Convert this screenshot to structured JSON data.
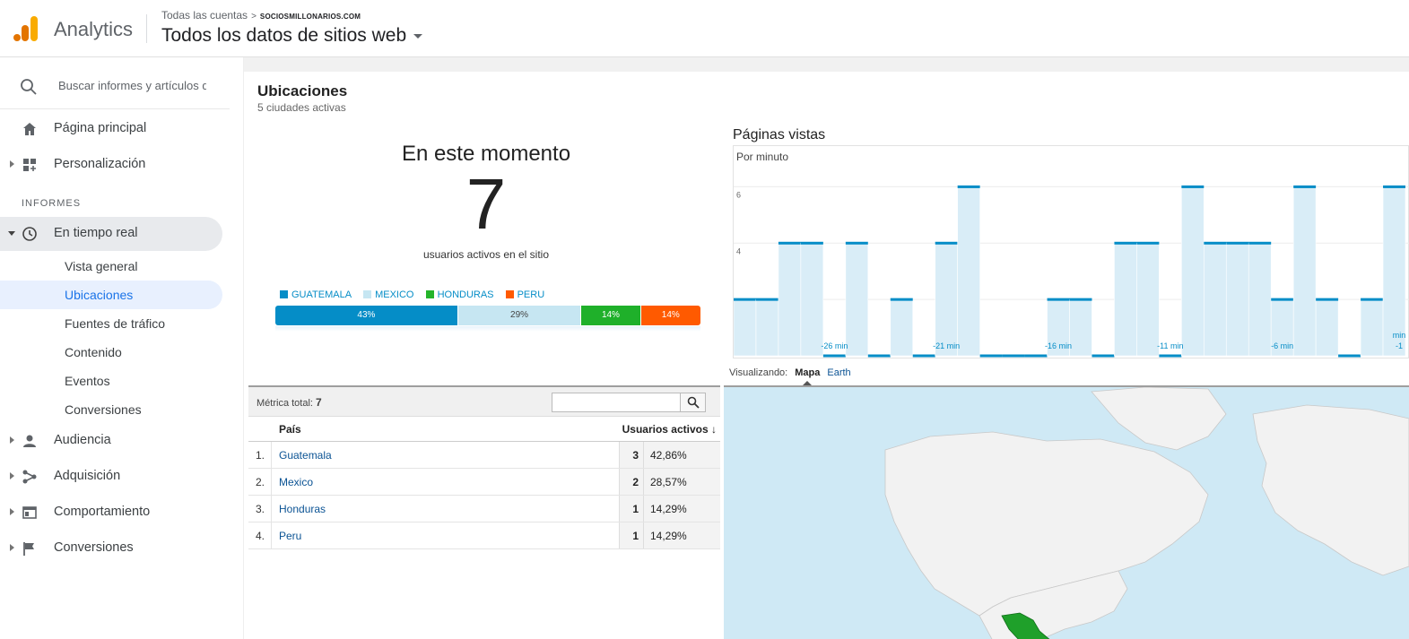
{
  "header": {
    "app_name": "Analytics",
    "breadcrumb_all": "Todas las cuentas",
    "breadcrumb_sep": ">",
    "breadcrumb_site": "SOCIOSMILLONARIOS.COM",
    "view_name": "Todos los datos de sitios web"
  },
  "sidebar": {
    "search_placeholder": "Buscar informes y artículos d",
    "home": "Página principal",
    "customization": "Personalización",
    "section_label": "INFORMES",
    "realtime": "En tiempo real",
    "realtime_items": [
      "Vista general",
      "Ubicaciones",
      "Fuentes de tráfico",
      "Contenido",
      "Eventos",
      "Conversiones"
    ],
    "audience": "Audiencia",
    "acquisition": "Adquisición",
    "behavior": "Comportamiento",
    "conversions": "Conversiones"
  },
  "main": {
    "title": "Ubicaciones",
    "subtitle": "5 ciudades activas",
    "now_title": "En este momento",
    "active_users": "7",
    "active_label": "usuarios activos en el sitio",
    "legend": [
      {
        "name": "GUATEMALA",
        "color": "#058dc7"
      },
      {
        "name": "MEXICO",
        "color": "#c6e6f2"
      },
      {
        "name": "HONDURAS",
        "color": "#24b42a"
      },
      {
        "name": "PERU",
        "color": "#ff5a00"
      }
    ],
    "share": [
      {
        "label": "43%",
        "value": 43,
        "color": "#058dc7"
      },
      {
        "label": "29%",
        "value": 29,
        "color": "#c6e6f2"
      },
      {
        "label": "14%",
        "value": 14,
        "color": "#1fb02a"
      },
      {
        "label": "14%",
        "value": 14,
        "color": "#ff5a00"
      }
    ],
    "table": {
      "metric_label": "Métrica total:",
      "metric_value": "7",
      "col_country": "País",
      "col_users": "Usuarios activos",
      "rows": [
        {
          "idx": "1.",
          "name": "Guatemala",
          "count": "3",
          "pct": "42,86%"
        },
        {
          "idx": "2.",
          "name": "Mexico",
          "count": "2",
          "pct": "28,57%"
        },
        {
          "idx": "3.",
          "name": "Honduras",
          "count": "1",
          "pct": "14,29%"
        },
        {
          "idx": "4.",
          "name": "Peru",
          "count": "1",
          "pct": "14,29%"
        }
      ]
    },
    "viz_label": "Visualizando:",
    "viz_map": "Mapa",
    "viz_earth": "Earth"
  },
  "chart_data": {
    "type": "bar",
    "title": "Páginas vistas",
    "ylabel": "Por minuto",
    "ylim": [
      0,
      7
    ],
    "yticks": [
      2,
      4,
      6
    ],
    "x_tick_labels": [
      "-26 min",
      "-21 min",
      "-16 min",
      "-11 min",
      "-6 min",
      "min -1"
    ],
    "values": [
      2,
      2,
      4,
      4,
      0,
      4,
      0,
      2,
      0,
      4,
      6,
      0,
      0,
      0,
      2,
      2,
      0,
      4,
      4,
      0,
      6,
      4,
      4,
      4,
      2,
      6,
      2,
      0,
      2,
      6
    ],
    "colors": {
      "fill": "#d9edf7",
      "line": "#058dc7",
      "grid": "#ececec"
    }
  }
}
